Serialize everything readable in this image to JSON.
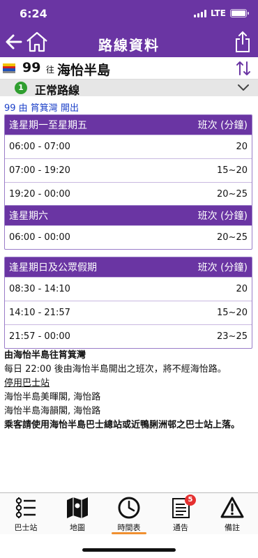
{
  "status": {
    "time": "6:24",
    "network": "LTE"
  },
  "nav": {
    "title": "路線資料"
  },
  "route": {
    "number": "99",
    "to_label": "往",
    "destination": "海怡半島"
  },
  "variant": {
    "index": "1",
    "label": "正常路線"
  },
  "departure": "99 由 筲箕灣 開出",
  "schedules": [
    {
      "title": "逢星期一至星期五",
      "freq_label": "班次 (分鐘)",
      "rows": [
        {
          "time": "06:00 - 07:00",
          "freq": "20"
        },
        {
          "time": "07:00 - 19:20",
          "freq": "15~20"
        },
        {
          "time": "19:20 - 00:00",
          "freq": "20~25"
        }
      ]
    },
    {
      "title": "逢星期六",
      "freq_label": "班次 (分鐘)",
      "rows": [
        {
          "time": "06:00 - 00:00",
          "freq": "20~25"
        }
      ]
    },
    {
      "title": "逢星期日及公眾假期",
      "freq_label": "班次 (分鐘)",
      "rows": [
        {
          "time": "08:30 - 14:10",
          "freq": "20"
        },
        {
          "time": "14:10 - 21:57",
          "freq": "15~20"
        },
        {
          "time": "21:57 - 00:00",
          "freq": "23~25"
        }
      ]
    }
  ],
  "notes": {
    "heading": "由海怡半島往筲箕灣",
    "line1": "每日 22:00 後由海怡半島開出之班次，將不經海怡路。",
    "suspended_heading": "停用巴士站",
    "stop1": "海怡半島美暉閣, 海怡路",
    "stop2": "海怡半島海韻閣, 海怡路",
    "advice": "乘客請使用海怡半島巴士總站或近鴨脷洲邨之巴士站上落。"
  },
  "tabs": [
    {
      "label": "巴士站"
    },
    {
      "label": "地圖"
    },
    {
      "label": "時間表"
    },
    {
      "label": "通告",
      "badge": "5"
    },
    {
      "label": "備註"
    }
  ],
  "colors": {
    "brand": "#6a35a3",
    "accent": "#f09030",
    "link": "#1a3fc8",
    "badge": "#e53030"
  }
}
